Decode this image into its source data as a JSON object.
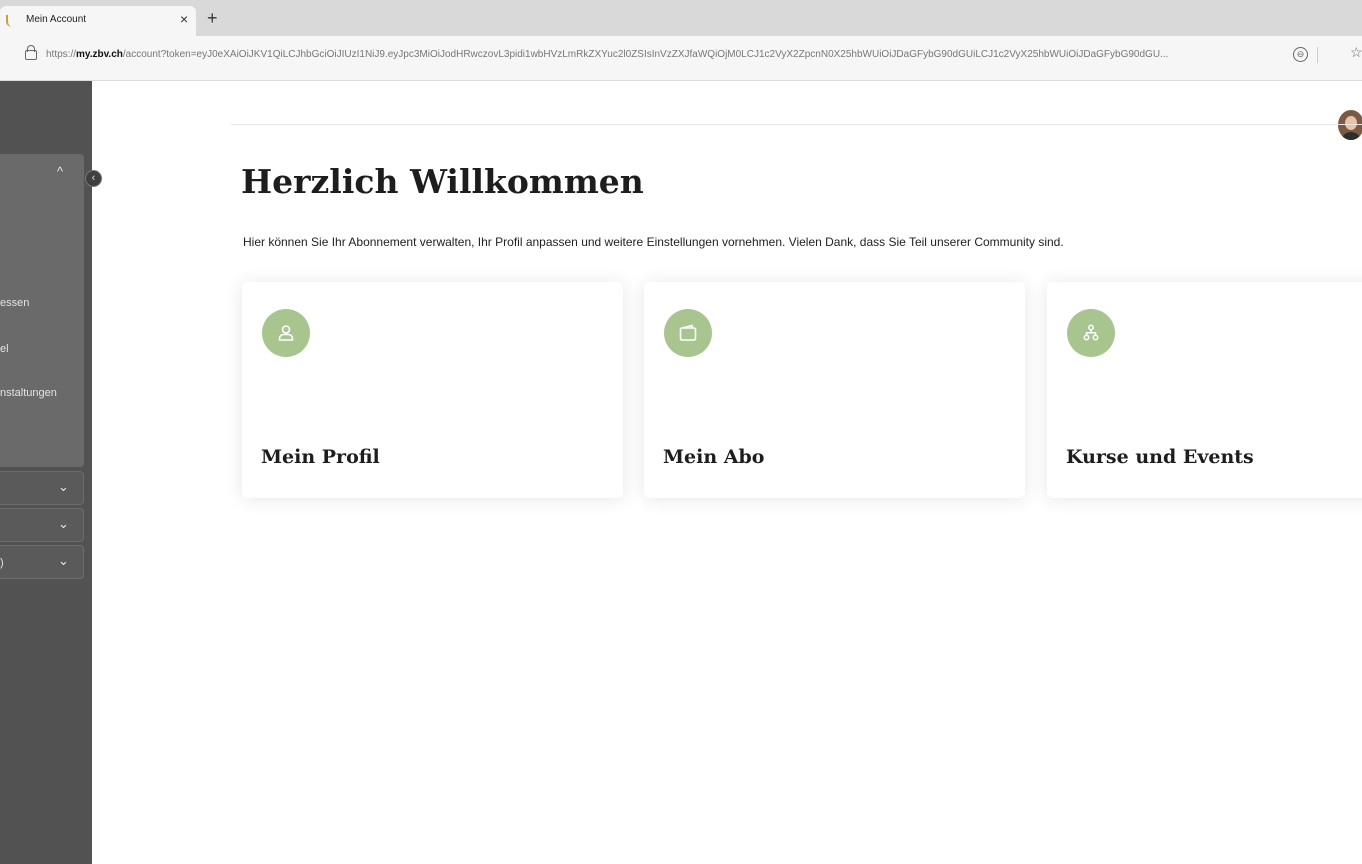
{
  "browser": {
    "tab_title": "Mein Account",
    "tab_close": "×",
    "new_tab": "+",
    "url_prefix": "https://",
    "url_host": "my.zbv.ch",
    "url_path": "/account?token=eyJ0eXAiOiJKV1QiLCJhbGciOiJIUzI1NiJ9.eyJpc3MiOiJodHRwczovL3pidi1wbHVzLmRkZXYuc2l0ZSIsInVzZXJfaWQiOjM0LCJ1c2VyX2ZpcnN0X25hbWUiOiJDaGFybG90dGUiLCJ1c2VyX25hbWUiOiJDaGFybG90dGU...",
    "zoom_icon": "⊖",
    "favorite_icon": "☆"
  },
  "sidebar": {
    "collapse_icon": "‹",
    "group_chevron": "^",
    "items": [
      {
        "label": "essen"
      },
      {
        "label": "el"
      },
      {
        "label": "nstaltungen"
      }
    ],
    "rows": [
      {
        "label": "",
        "chevron": "⌄"
      },
      {
        "label": "",
        "chevron": "⌄"
      },
      {
        "label": ")",
        "chevron": "⌄"
      }
    ]
  },
  "main": {
    "title": "Herzlich Willkommen",
    "intro": "Hier können Sie Ihr Abonnement verwalten, Ihr Profil anpassen und weitere Einstellungen vornehmen. Vielen Dank, dass Sie Teil unserer Community sind.",
    "cards": [
      {
        "label": "Mein Profil",
        "icon": "user-icon"
      },
      {
        "label": "Mein Abo",
        "icon": "wallet-icon"
      },
      {
        "label": "Kurse und Events",
        "icon": "sitemap-icon"
      }
    ]
  },
  "colors": {
    "accent": "#a8c48f",
    "sidebar": "#525252",
    "text": "#1d1d1d"
  }
}
